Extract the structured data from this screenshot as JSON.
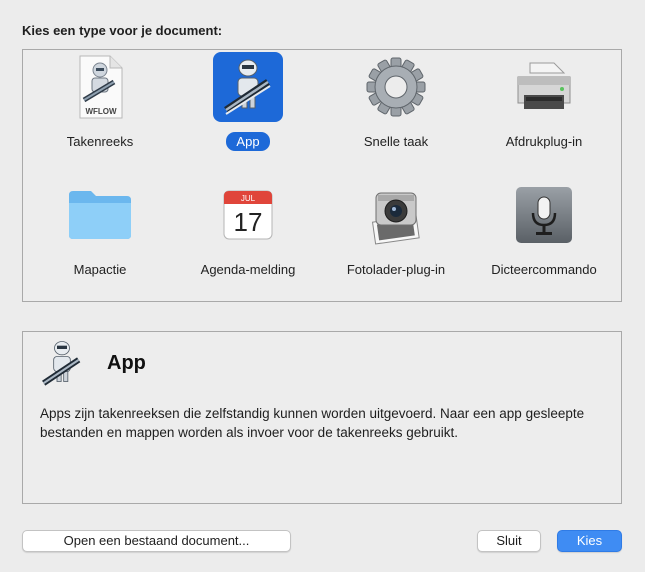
{
  "heading": "Kies een type voor je document:",
  "tiles": [
    {
      "label": "Takenreeks",
      "icon": "workflow-file-icon",
      "badge": "WFLOW"
    },
    {
      "label": "App",
      "icon": "automator-robot-icon",
      "selected": true
    },
    {
      "label": "Snelle taak",
      "icon": "gear-icon"
    },
    {
      "label": "Afdrukplug-in",
      "icon": "printer-icon"
    },
    {
      "label": "Mapactie",
      "icon": "folder-icon"
    },
    {
      "label": "Agenda-melding",
      "icon": "calendar-icon",
      "month": "JUL",
      "day": "17"
    },
    {
      "label": "Fotolader-plug-in",
      "icon": "camera-photos-icon"
    },
    {
      "label": "Dicteercommando",
      "icon": "microphone-icon"
    }
  ],
  "description": {
    "title": "App",
    "text": "Apps zijn takenreeksen die zelfstandig kunnen worden uitgevoerd. Naar een app gesleepte bestanden en mappen worden als invoer voor de takenreeks gebruikt."
  },
  "buttons": {
    "open": "Open een bestaand document...",
    "close": "Sluit",
    "choose": "Kies"
  },
  "colors": {
    "accent": "#1d69d8",
    "primary_button": "#3f8cf3",
    "background": "#ececec"
  }
}
